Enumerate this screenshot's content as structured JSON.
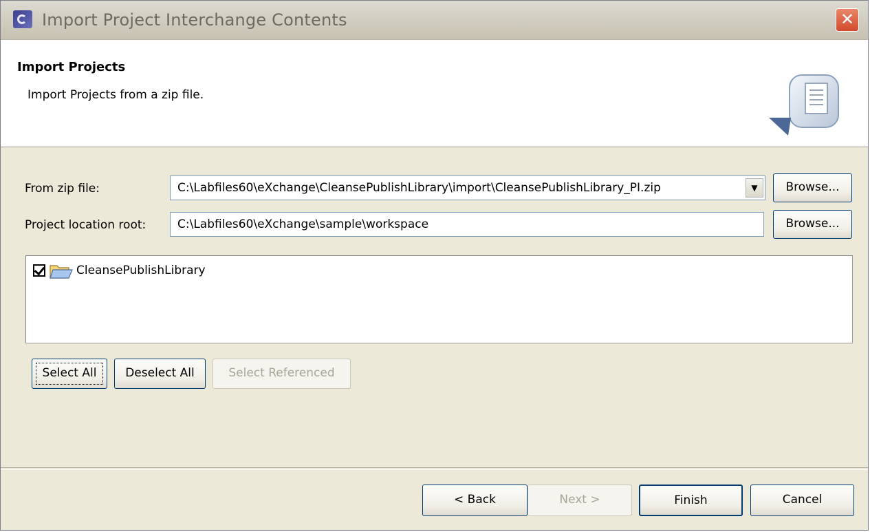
{
  "window": {
    "title": "Import Project Interchange Contents",
    "close_glyph": "✕"
  },
  "header": {
    "title": "Import Projects",
    "description": "Import Projects from a zip file."
  },
  "form": {
    "zip_label": "From zip file:",
    "zip_value": "C:\\Labfiles60\\eXchange\\CleansePublishLibrary\\import\\CleansePublishLibrary_PI.zip",
    "zip_browse": "Browse...",
    "root_label": "Project location root:",
    "root_value": "C:\\Labfiles60\\eXchange\\sample\\workspace",
    "root_browse": "Browse..."
  },
  "projects": [
    {
      "label": "CleansePublishLibrary",
      "checked": true
    }
  ],
  "selection_buttons": {
    "select_all": "Select All",
    "deselect_all": "Deselect All",
    "select_referenced": "Select Referenced"
  },
  "footer": {
    "back": "< Back",
    "next": "Next >",
    "finish": "Finish",
    "cancel": "Cancel"
  }
}
